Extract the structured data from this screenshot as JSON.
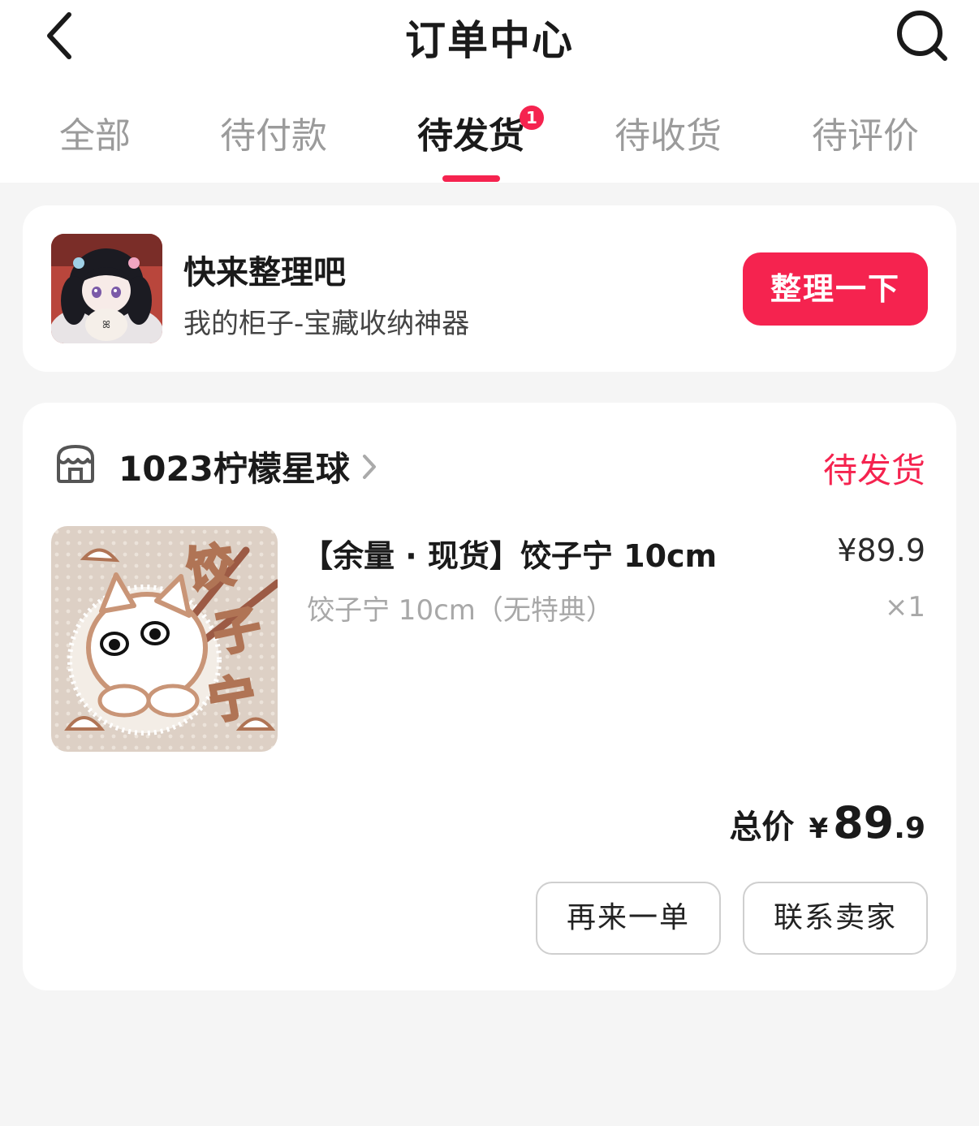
{
  "header": {
    "title": "订单中心",
    "back_icon": "chevron-left-icon",
    "search_icon": "search-icon"
  },
  "tabs": [
    {
      "label": "全部",
      "active": false
    },
    {
      "label": "待付款",
      "active": false
    },
    {
      "label": "待发货",
      "active": true,
      "badge": "1"
    },
    {
      "label": "待收货",
      "active": false
    },
    {
      "label": "待评价",
      "active": false
    }
  ],
  "promo": {
    "title": "快来整理吧",
    "subtitle": "我的柜子-宝藏收纳神器",
    "button_label": "整理一下"
  },
  "order": {
    "shop_name": "1023柠檬星球",
    "status": "待发货",
    "product": {
      "title": "【余量 · 现货】饺子宁 10cm",
      "variant": "饺子宁 10cm（无特典）",
      "price": "¥89.9",
      "quantity": "×1",
      "image_text": [
        "饺",
        "子",
        "宁"
      ]
    },
    "total": {
      "label": "总价",
      "currency": "¥",
      "integer": "89",
      "decimal": ".9"
    },
    "actions": {
      "reorder_label": "再来一单",
      "contact_label": "联系卖家"
    }
  },
  "colors": {
    "accent": "#f5234f",
    "background": "#f5f5f5",
    "muted_text": "#a8a8a8"
  }
}
